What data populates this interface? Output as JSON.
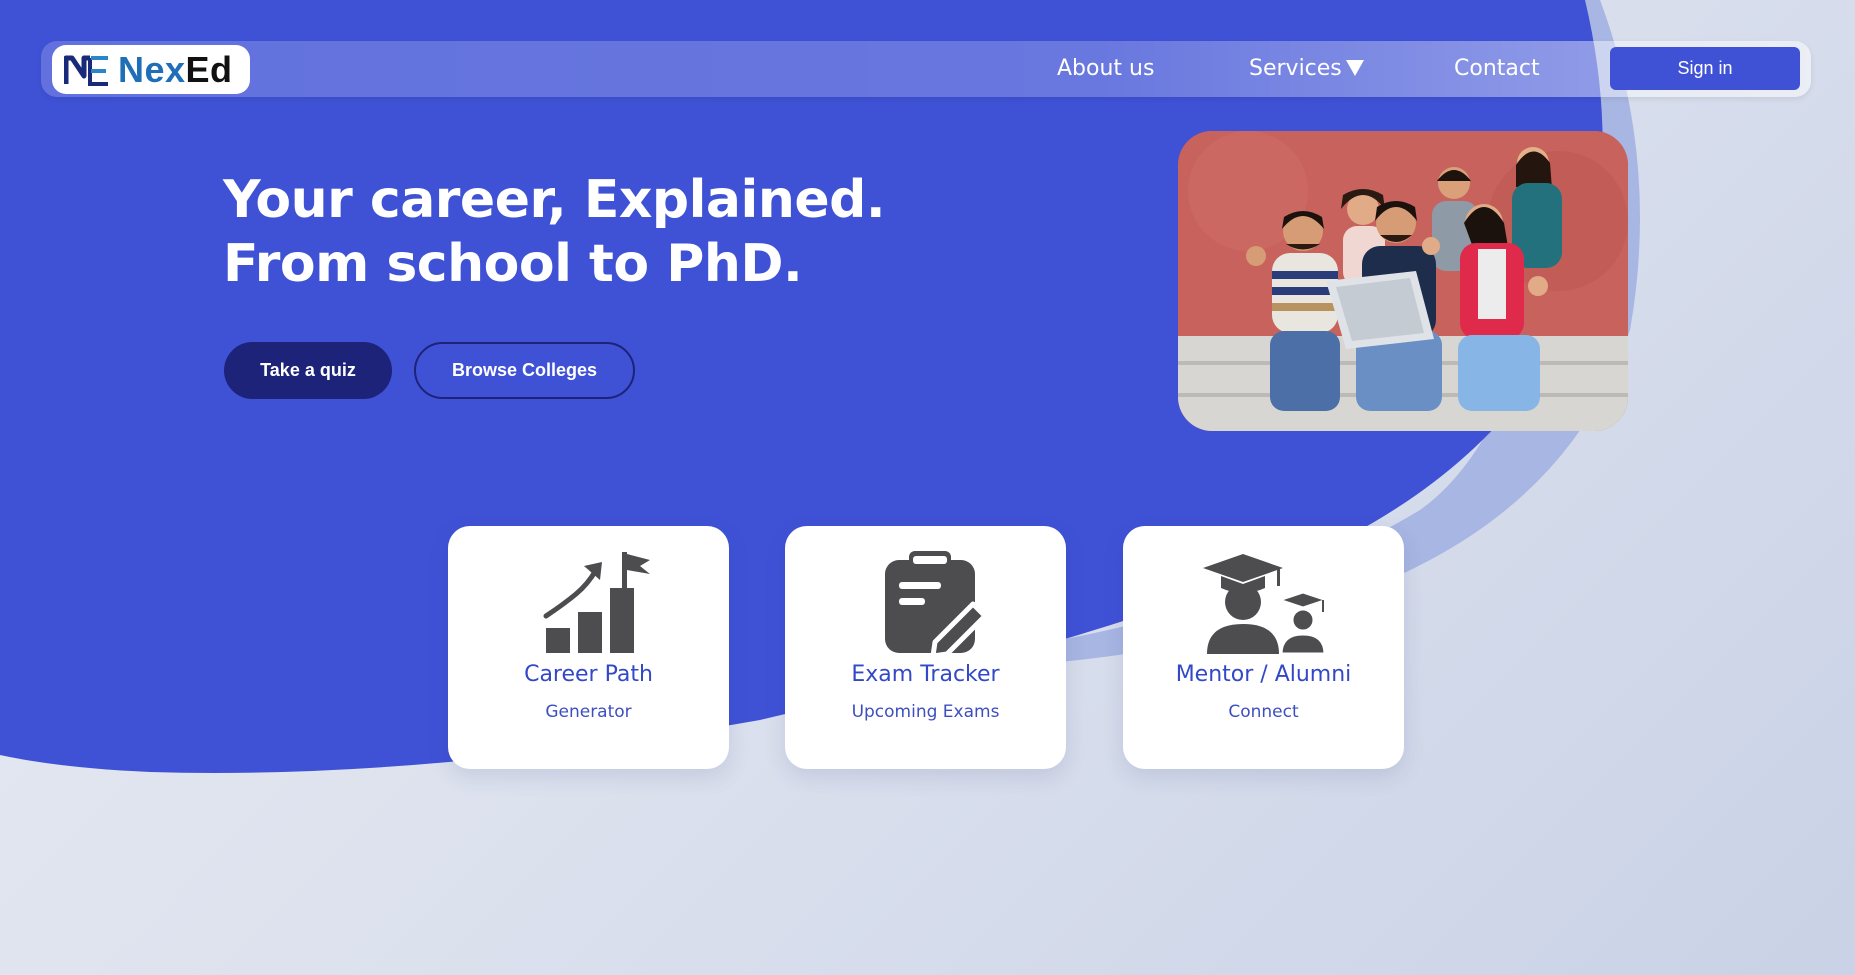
{
  "brand": {
    "name_part1": "Nex",
    "name_part2": "Ed",
    "mark_icon": "NE-monogram-icon"
  },
  "nav": {
    "links": [
      {
        "label": "About us"
      },
      {
        "label": "Services"
      },
      {
        "label": "Contact"
      }
    ],
    "services_caret_icon": "triangle-down-icon",
    "signin_label": "Sign in"
  },
  "hero": {
    "title_line1": "Your career, Explained.",
    "title_line2": "From school to PhD.",
    "primary_button": "Take a quiz",
    "secondary_button": "Browse Colleges",
    "image_subject": "students-with-laptop-photo"
  },
  "cards": [
    {
      "title": "Career Path",
      "subtitle": "Generator",
      "icon": "chart-growth-flag-icon"
    },
    {
      "title": "Exam Tracker",
      "subtitle": "Upcoming Exams",
      "icon": "clipboard-pen-icon"
    },
    {
      "title": "Mentor / Alumni",
      "subtitle": "Connect",
      "icon": "graduates-icon"
    }
  ],
  "colors": {
    "primary_blue": "#3f52d6",
    "dark_navy": "#1c2378",
    "card_text": "#3248c7",
    "icon_gray": "#4d4d4f",
    "background": "#e3e7f1"
  }
}
